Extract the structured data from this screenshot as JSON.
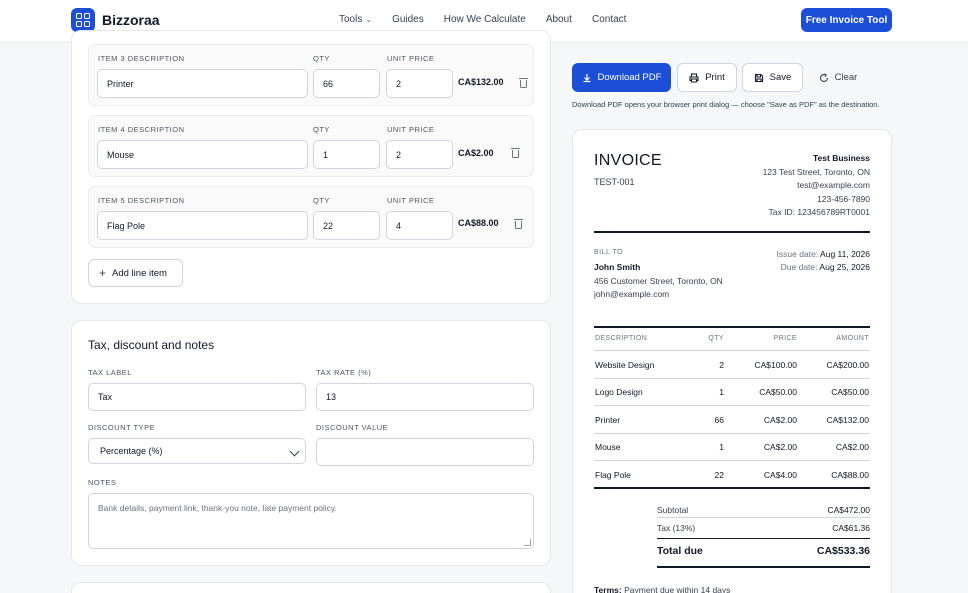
{
  "header": {
    "brand": "Bizzoraa",
    "nav": [
      {
        "label": "Tools",
        "has_dropdown": true
      },
      {
        "label": "Guides"
      },
      {
        "label": "How We Calculate"
      },
      {
        "label": "About"
      },
      {
        "label": "Contact"
      }
    ],
    "cta_label": "Free Invoice Tool"
  },
  "line_items": [
    {
      "desc_label": "ITEM 3 DESCRIPTION",
      "qty_label": "QTY",
      "price_label": "UNIT PRICE",
      "description": "Printer",
      "qty": "66",
      "unit_price": "2",
      "amount": "CA$132.00"
    },
    {
      "desc_label": "ITEM 4 DESCRIPTION",
      "qty_label": "QTY",
      "price_label": "UNIT PRICE",
      "description": "Mouse",
      "qty": "1",
      "unit_price": "2",
      "amount": "CA$2.00"
    },
    {
      "desc_label": "ITEM 5 DESCRIPTION",
      "qty_label": "QTY",
      "price_label": "UNIT PRICE",
      "description": "Flag Pole",
      "qty": "22",
      "unit_price": "4",
      "amount": "CA$88.00"
    }
  ],
  "add_line_item_label": "Add line item",
  "tax_section": {
    "title": "Tax, discount and notes",
    "tax_label_label": "TAX LABEL",
    "tax_label_value": "Tax",
    "tax_rate_label": "TAX RATE (%)",
    "tax_rate_value": "13",
    "discount_type_label": "DISCOUNT TYPE",
    "discount_type_value": "Percentage (%)",
    "discount_value_label": "DISCOUNT VALUE",
    "discount_value": "",
    "notes_label": "NOTES",
    "notes_placeholder": "Bank details, payment link, thank-you note, late payment policy."
  },
  "toolbar": {
    "download_label": "Download PDF",
    "print_label": "Print",
    "save_label": "Save",
    "clear_label": "Clear",
    "hint": "Download PDF opens your browser print dialog — choose \"Save as PDF\" as the destination."
  },
  "invoice": {
    "title": "INVOICE",
    "number": "TEST-001",
    "business": {
      "name": "Test Business",
      "address": "123 Test Street, Toronto, ON",
      "email": "test@example.com",
      "phone": "123-456-7890",
      "tax_id": "Tax ID: 123456789RT0001"
    },
    "bill_to_label": "BILL TO",
    "client": {
      "name": "John Smith",
      "address": "456 Customer Street, Toronto, ON",
      "email": "john@example.com"
    },
    "issue_date_label": "Issue date:",
    "issue_date": "Aug 11, 2026",
    "due_date_label": "Due date:",
    "due_date": "Aug 25, 2026",
    "columns": [
      "DESCRIPTION",
      "QTY",
      "PRICE",
      "AMOUNT"
    ],
    "rows": [
      {
        "description": "Website Design",
        "qty": "2",
        "price": "CA$100.00",
        "amount": "CA$200.00"
      },
      {
        "description": "Logo Design",
        "qty": "1",
        "price": "CA$50.00",
        "amount": "CA$50.00"
      },
      {
        "description": "Printer",
        "qty": "66",
        "price": "CA$2.00",
        "amount": "CA$132.00"
      },
      {
        "description": "Mouse",
        "qty": "1",
        "price": "CA$2.00",
        "amount": "CA$2.00"
      },
      {
        "description": "Flag Pole",
        "qty": "22",
        "price": "CA$4.00",
        "amount": "CA$88.00"
      }
    ],
    "subtotal_label": "Subtotal",
    "subtotal": "CA$472.00",
    "tax_line_label": "Tax (13%)",
    "tax_amount": "CA$61.36",
    "total_label": "Total due",
    "total": "CA$533.36",
    "terms_label": "Terms:",
    "terms_text": "Payment due within 14 days"
  },
  "colors": {
    "accent": "#1d4ed8",
    "border": "#e5e7eb",
    "text": "#111827"
  },
  "icons": [
    "grid-logo-icon",
    "chevron-down-icon",
    "trash-icon",
    "plus-icon",
    "download-icon",
    "printer-icon",
    "save-icon",
    "refresh-icon"
  ]
}
